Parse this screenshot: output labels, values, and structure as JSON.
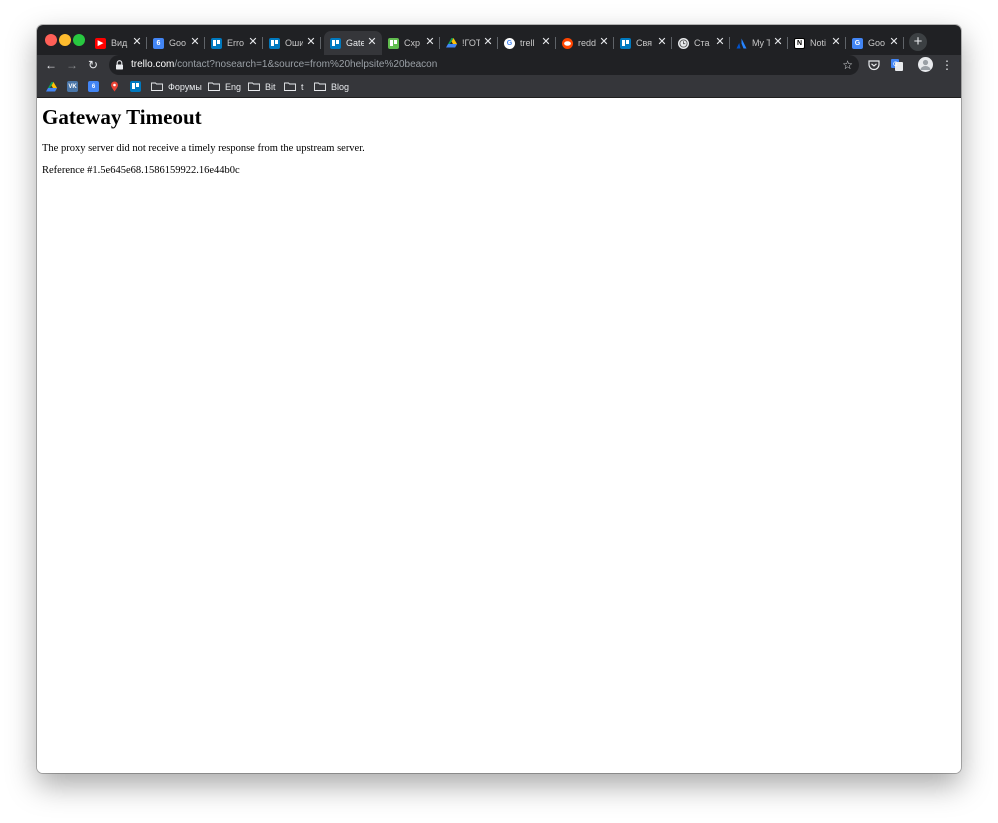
{
  "browser": {
    "tabs": [
      {
        "title": "Вид",
        "icon": "youtube-icon",
        "color": "#ff0000",
        "glyph": "▶",
        "active": false
      },
      {
        "title": "Goo",
        "icon": "google-calendar-icon",
        "color": "#4285f4",
        "glyph": "6",
        "active": false
      },
      {
        "title": "Erro",
        "icon": "trello-icon",
        "color": "#0079bf",
        "glyph": "",
        "active": false
      },
      {
        "title": "Оши",
        "icon": "trello-icon",
        "color": "#0079bf",
        "glyph": "",
        "active": false
      },
      {
        "title": "Gate",
        "icon": "trello-icon",
        "color": "#0079bf",
        "glyph": "",
        "active": true
      },
      {
        "title": "Схр",
        "icon": "trello-green-icon",
        "color": "#61bd4f",
        "glyph": "",
        "active": false
      },
      {
        "title": "!ГОТ",
        "icon": "google-drive-icon",
        "color": "#34a853",
        "glyph": "▲",
        "active": false
      },
      {
        "title": "trell",
        "icon": "google-icon",
        "color": "#ffffff",
        "glyph": "G",
        "active": false
      },
      {
        "title": "redd",
        "icon": "reddit-icon",
        "color": "#ff4500",
        "glyph": "•",
        "active": false
      },
      {
        "title": "Свя",
        "icon": "trello-icon",
        "color": "#0079bf",
        "glyph": "",
        "active": false
      },
      {
        "title": "Ста",
        "icon": "clock-icon",
        "color": "#e8eaed",
        "glyph": "◷",
        "active": false
      },
      {
        "title": "My T",
        "icon": "atlassian-icon",
        "color": "#2684ff",
        "glyph": "▲",
        "active": false
      },
      {
        "title": "Noti",
        "icon": "notion-icon",
        "color": "#ffffff",
        "glyph": "N",
        "active": false
      },
      {
        "title": "Goo",
        "icon": "google-translate-icon",
        "color": "#4285f4",
        "glyph": "G",
        "active": false
      }
    ],
    "address": {
      "host": "trello.com",
      "path": "/contact?nosearch=1&source=from%20helpsite%20beacon"
    },
    "bookmarks": [
      {
        "type": "icon",
        "icon": "google-drive-icon"
      },
      {
        "type": "icon",
        "icon": "vk-icon"
      },
      {
        "type": "icon",
        "icon": "google-calendar-icon"
      },
      {
        "type": "icon",
        "icon": "maps-pin-icon"
      },
      {
        "type": "icon",
        "icon": "trello-icon"
      },
      {
        "type": "folder",
        "label": "Форумы"
      },
      {
        "type": "folder",
        "label": "Eng"
      },
      {
        "type": "folder",
        "label": "Bit"
      },
      {
        "type": "folder",
        "label": "t"
      },
      {
        "type": "folder",
        "label": "Blog"
      }
    ],
    "colors": {
      "tabstrip": "#202124",
      "toolbar": "#35363a",
      "text": "#e8eaed"
    }
  },
  "page": {
    "title": "Gateway Timeout",
    "message": "The proxy server did not receive a timely response from the upstream server.",
    "reference": "Reference #1.5e645e68.1586159922.16e44b0c"
  }
}
